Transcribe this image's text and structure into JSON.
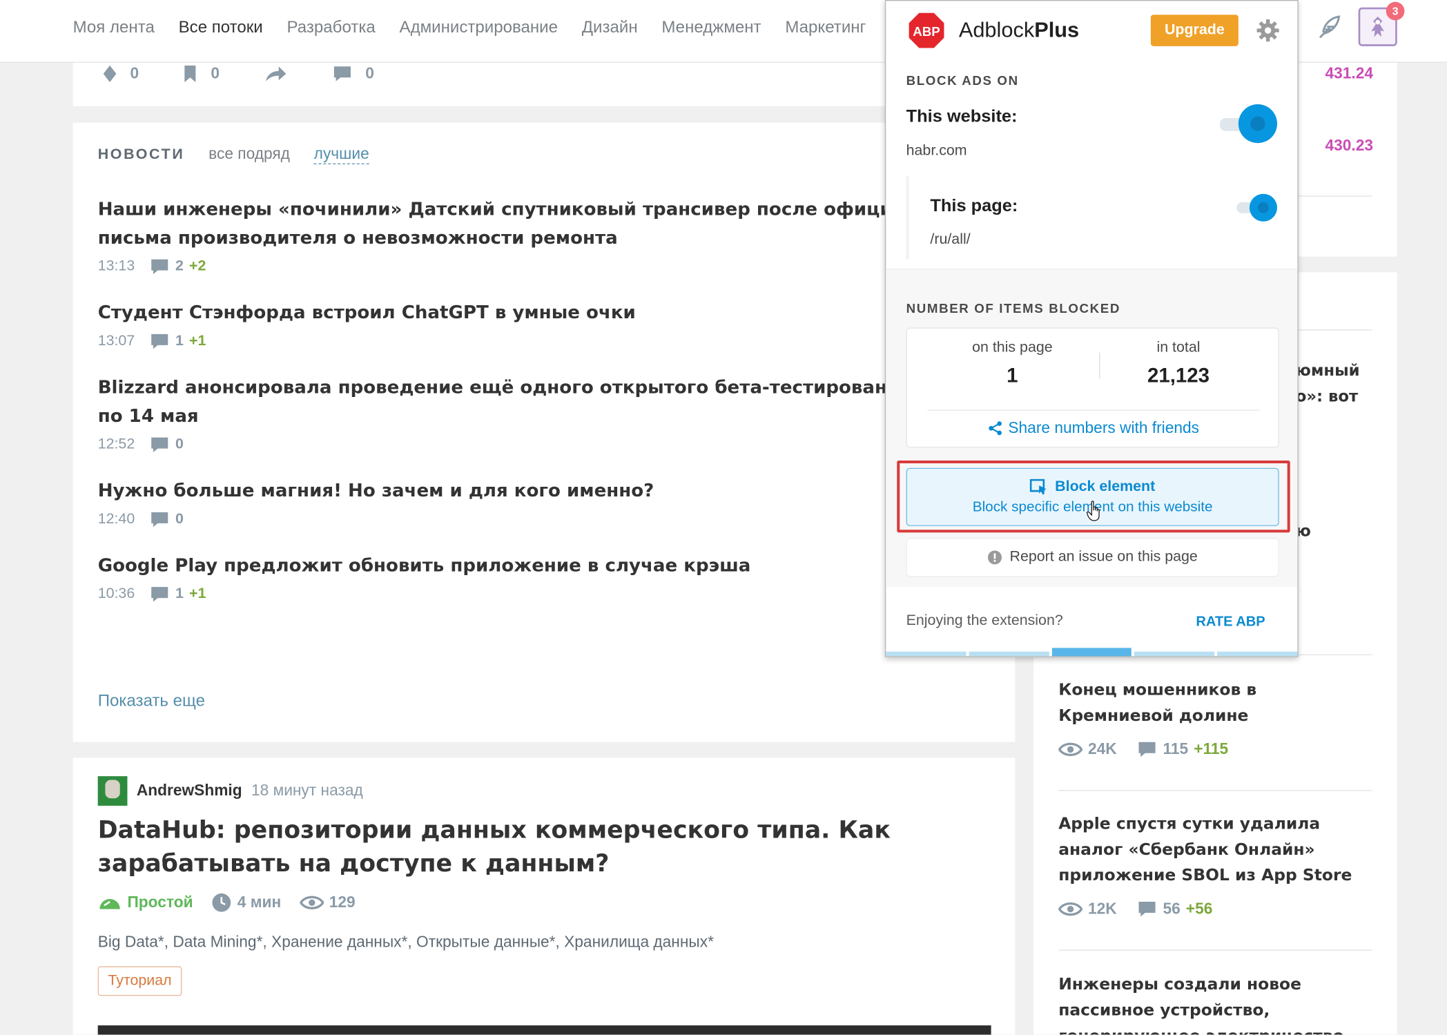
{
  "nav": [
    "Моя лента",
    "Все потоки",
    "Разработка",
    "Администрирование",
    "Дизайн",
    "Менеджмент",
    "Маркетинг"
  ],
  "topstats": {
    "votes": "0",
    "bookmarks": "0",
    "comments": "0"
  },
  "news": {
    "title": "НОВОСТИ",
    "filters": [
      "все подряд",
      "лучшие"
    ],
    "items": [
      {
        "title": "Наши инженеры «починили» Датский спутниковый трансивер после официального",
        "title2": "письма производителя о невозможности ремонта",
        "time": "13:13",
        "comments": "2",
        "plus": "+2"
      },
      {
        "title": "Студент Стэнфорда встроил ChatGPT в умные очки",
        "title2": "",
        "time": "13:07",
        "comments": "1",
        "plus": "+1"
      },
      {
        "title": "Blizzard анонсировала проведение ещё одного открытого бета-тестирования Diablo IV",
        "title2": "по 14 мая",
        "time": "12:52",
        "comments": "0",
        "plus": ""
      },
      {
        "title": "Нужно больше магния! Но зачем и для кого именно?",
        "title2": "",
        "time": "12:40",
        "comments": "0",
        "plus": ""
      },
      {
        "title": "Google Play предложит обновить приложение в случае крэша",
        "title2": "",
        "time": "10:36",
        "comments": "1",
        "plus": "+1"
      }
    ],
    "show_more": "Показать еще"
  },
  "post": {
    "author": "AndrewShmig",
    "time": "18 минут назад",
    "title": "DataHub: репозитории данных коммерческого типа. Как зарабатывать на доступе к данным?",
    "difficulty": "Простой",
    "read_time": "4 мин",
    "views": "129",
    "tags": "Big Data*, Data Mining*, Хранение данных*, Открытые данные*, Хранилища данных*",
    "badge": "Туториал"
  },
  "right": {
    "prices": [
      "431.24",
      "430.23"
    ],
    "partial1": "юмный",
    "partial2": "о»: вот",
    "partial3": "ю",
    "articles": [
      {
        "title": "Конец мошенников в Кремниевой долине",
        "views": "24K",
        "comments": "115",
        "plus": "+115"
      },
      {
        "title": "Apple спустя сутки удалила аналог «Сбербанк Онлайн» приложение SBOL из App Store",
        "views": "12K",
        "comments": "56",
        "plus": "+56"
      },
      {
        "title": "Инженеры создали новое пассивное устройство, генерирующее электричество днём и ночью",
        "views": "",
        "comments": "",
        "plus": ""
      }
    ]
  },
  "user_badge": "3",
  "abp": {
    "brand_light": "Adblock",
    "brand_bold": "Plus",
    "logo_text": "ABP",
    "upgrade": "Upgrade",
    "block_ads_on": "BLOCK ADS ON",
    "this_website": "This website:",
    "domain": "habr.com",
    "this_page": "This page:",
    "page_path": "/ru/all/",
    "items_blocked": "NUMBER OF ITEMS BLOCKED",
    "on_page_label": "on this page",
    "on_page_value": "1",
    "total_label": "in total",
    "total_value": "21,123",
    "share": "Share numbers with friends",
    "block_element": "Block element",
    "block_element_sub": "Block specific element on this website",
    "report": "Report an issue on this page",
    "enjoy": "Enjoying the extension?",
    "rate": "RATE ABP",
    "accent": "#0797e1",
    "brand_red": "#e4252c"
  }
}
